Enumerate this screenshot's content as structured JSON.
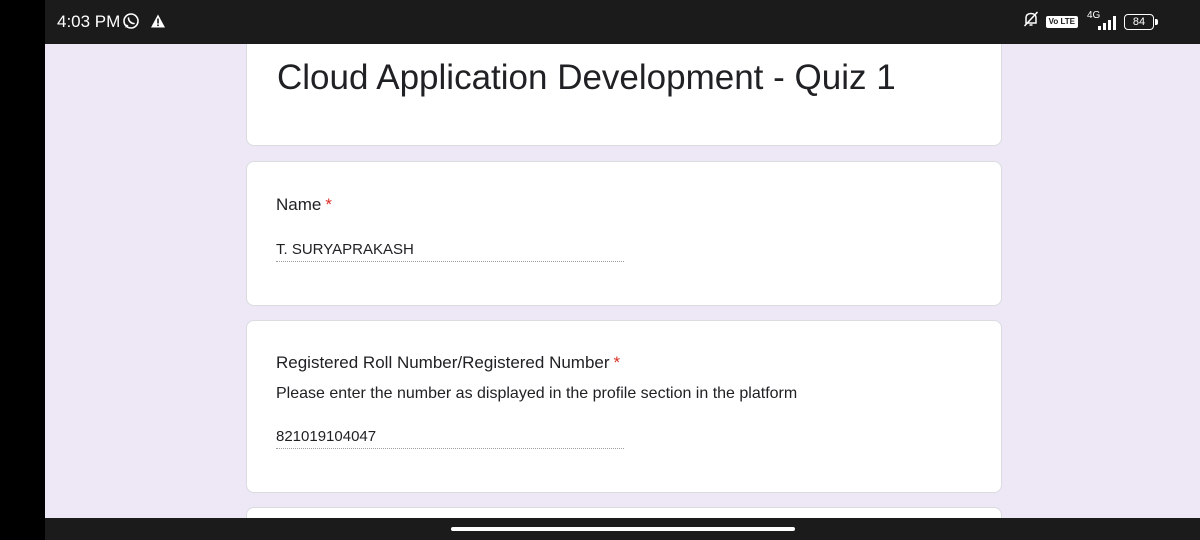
{
  "status_bar": {
    "time": "4:03 PM",
    "network": "4G",
    "battery": "84",
    "volte": "Vo LTE",
    "left_icons": [
      "whatsapp-icon",
      "alert-triangle-icon"
    ],
    "right_icons": [
      "bell-off-icon",
      "volte-icon",
      "signal-icon",
      "battery-icon"
    ]
  },
  "form": {
    "title": "Cloud Application Development - Quiz 1",
    "questions": [
      {
        "title": "Name",
        "required_mark": "*",
        "description": "",
        "answer": "T. SURYAPRAKASH"
      },
      {
        "title": "Registered Roll Number/Registered Number",
        "required_mark": "*",
        "description": "Please enter the number as displayed in the profile section in the platform",
        "answer": "821019104047"
      }
    ]
  },
  "feedback": {
    "glyph": "!"
  },
  "colors": {
    "page_bg": "#ede7f6",
    "theme": "#4a2a8a",
    "required": "#d93025",
    "status_bar": "#1b1b1b"
  }
}
